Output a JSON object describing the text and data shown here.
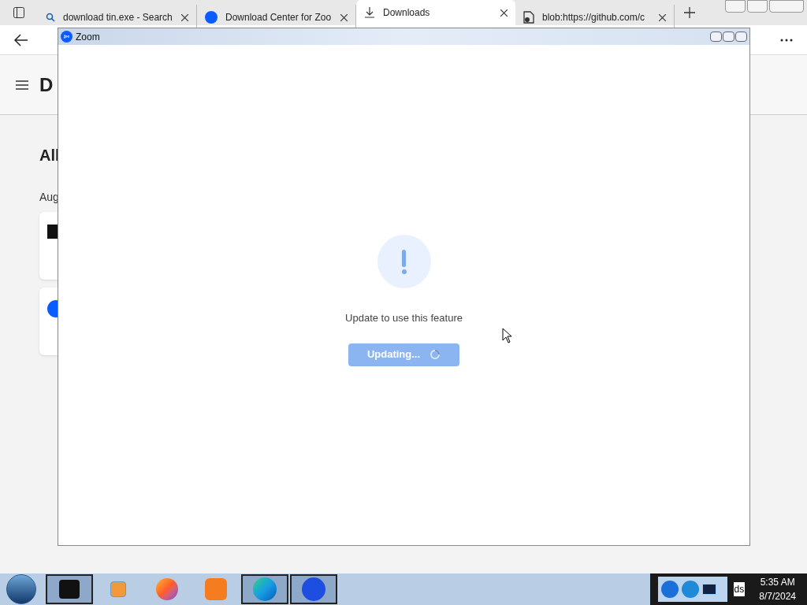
{
  "browser": {
    "tabs": [
      {
        "label": "download tin.exe - Search",
        "kind": "search",
        "selected": false
      },
      {
        "label": "Download Center for Zoo",
        "kind": "zoom",
        "selected": false
      },
      {
        "label": "Downloads",
        "kind": "download",
        "selected": true
      },
      {
        "label": "blob:https://github.com/c",
        "kind": "file",
        "selected": false
      }
    ]
  },
  "page": {
    "heading": "D",
    "section_title": "All",
    "date_label": "Aug",
    "items": [
      {
        "kind": "app"
      },
      {
        "kind": "zoom"
      }
    ]
  },
  "dialog": {
    "title": "Zoom",
    "message": "Update to use this feature",
    "button": {
      "label": "Updating...",
      "disabled": true
    }
  },
  "taskbar": {
    "apps": [
      {
        "kind": "app",
        "active": true
      },
      {
        "kind": "media",
        "active": false
      },
      {
        "kind": "firefox",
        "active": false
      },
      {
        "kind": "uc",
        "active": false
      },
      {
        "kind": "edge",
        "active": true
      },
      {
        "kind": "zoom",
        "active": true
      }
    ],
    "tray_text": "ds",
    "time": "5:35 AM",
    "date": "8/7/2024"
  }
}
